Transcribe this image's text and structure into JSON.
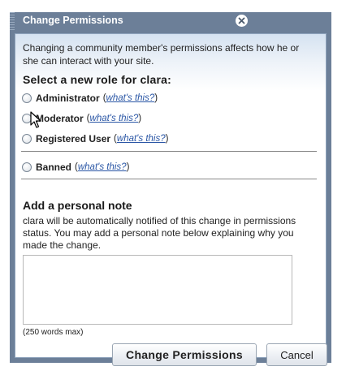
{
  "dialog": {
    "title": "Change Permissions",
    "intro": "Changing a community member's permissions affects how he or she can interact with your site.",
    "role_heading": "Select a new role for clara:",
    "roles": [
      {
        "label": "Administrator",
        "help": "what's this?",
        "selected": false
      },
      {
        "label": "Moderator",
        "help": "what's this?",
        "selected": false
      },
      {
        "label": "Registered User",
        "help": "what's this?",
        "selected": false
      },
      {
        "label": "Banned",
        "help": "what's this?",
        "selected": false
      }
    ],
    "note_heading": "Add a personal note",
    "note_description": "clara will be automatically notified of this change in permissions status. You may add a personal note below explaining why you made the change.",
    "note_value": "",
    "word_limit": "(250 words max)",
    "submit_label": "Change Permissions",
    "cancel_label": "Cancel"
  },
  "colors": {
    "frame": "#6c7f98",
    "link": "#2a56a5",
    "panel_top": "#d5e2f1"
  },
  "icons": {
    "close": "close-circle-icon",
    "cursor": "mouse-pointer-icon",
    "grip": "drag-grip-icon"
  }
}
